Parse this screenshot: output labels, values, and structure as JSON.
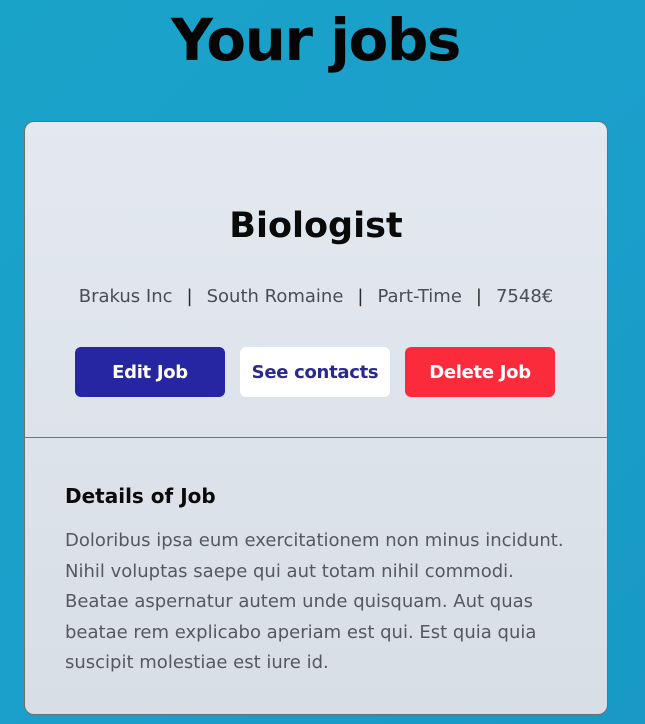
{
  "page": {
    "title": "Your jobs"
  },
  "job": {
    "title": "Biologist",
    "company": "Brakus Inc",
    "location": "South Romaine",
    "type": "Part-Time",
    "salary": "7548€",
    "separator": "|",
    "buttons": {
      "edit": "Edit Job",
      "contacts": "See contacts",
      "delete": "Delete Job"
    },
    "details": {
      "heading": "Details of Job",
      "body": "Doloribus ipsa eum exercitationem non minus incidunt. Nihil voluptas saepe qui aut totam nihil commodi. Beatae aspernatur autem unde quisquam. Aut quas beatae rem explicabo aperiam est qui. Est quia quia suscipit molestiae est iure id."
    }
  },
  "colors": {
    "background": "#1aa3c9",
    "edit_button": "#2626a3",
    "contacts_button": "#ffffff",
    "delete_button": "#fb2b3b"
  }
}
